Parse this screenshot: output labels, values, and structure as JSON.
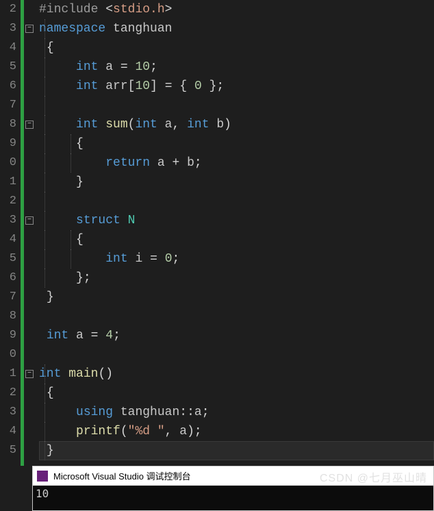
{
  "lineStart": 2,
  "lineEnd": 25,
  "lineNumbers": [
    "2",
    "3",
    "4",
    "5",
    "6",
    "7",
    "8",
    "9",
    "0",
    "1",
    "2",
    "3",
    "4",
    "5",
    "6",
    "7",
    "8",
    "9",
    "0",
    "1",
    "2",
    "3",
    "4",
    "5"
  ],
  "foldMarkers": [
    {
      "line": 3,
      "symbol": "−"
    },
    {
      "line": 8,
      "symbol": "−"
    },
    {
      "line": 13,
      "symbol": "−"
    },
    {
      "line": 21,
      "symbol": "−"
    }
  ],
  "code": {
    "l2": {
      "include": "#include",
      "open": "<",
      "hdr": "stdio.h",
      "close": ">"
    },
    "l3": {
      "kw": "namespace",
      "name": "tanghuan"
    },
    "l4": {
      "brace": "{"
    },
    "l5": {
      "type": "int",
      "name": "a",
      "eq": "=",
      "val": "10",
      "semi": ";"
    },
    "l6": {
      "type": "int",
      "name": "arr",
      "lb": "[",
      "sz": "10",
      "rb": "]",
      "eq": "=",
      "lc": "{",
      "val": "0",
      "rc": "}",
      "semi": ";"
    },
    "l8": {
      "type": "int",
      "fn": "sum",
      "lp": "(",
      "t1": "int",
      "p1": "a",
      "comma": ",",
      "t2": "int",
      "p2": "b",
      "rp": ")"
    },
    "l9": {
      "brace": "{"
    },
    "l10": {
      "kw": "return",
      "e1": "a",
      "op": "+",
      "e2": "b",
      "semi": ";"
    },
    "l11": {
      "brace": "}"
    },
    "l13": {
      "kw": "struct",
      "name": "N"
    },
    "l14": {
      "brace": "{"
    },
    "l15": {
      "type": "int",
      "name": "i",
      "eq": "=",
      "val": "0",
      "semi": ";"
    },
    "l16": {
      "brace": "}",
      "semi": ";"
    },
    "l17": {
      "brace": "}"
    },
    "l19": {
      "type": "int",
      "name": "a",
      "eq": "=",
      "val": "4",
      "semi": ";"
    },
    "l21": {
      "type": "int",
      "fn": "main",
      "lp": "(",
      "rp": ")"
    },
    "l22": {
      "brace": "{"
    },
    "l23": {
      "kw": "using",
      "ns": "tanghuan",
      "dcolon": "::",
      "name": "a",
      "semi": ";"
    },
    "l24": {
      "fn": "printf",
      "lp": "(",
      "str": "\"%d \"",
      "comma": ",",
      "arg": "a",
      "rp": ")",
      "semi": ";"
    },
    "l25": {
      "brace": "}"
    }
  },
  "console": {
    "title": "Microsoft Visual Studio 调试控制台",
    "output": "10"
  },
  "watermark": "CSDN @七月巫山晴"
}
